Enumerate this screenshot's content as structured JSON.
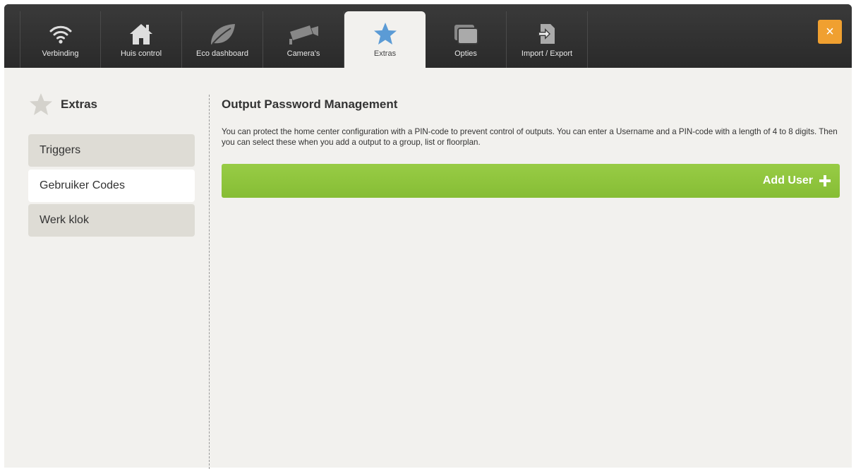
{
  "topbar": {
    "tabs": [
      {
        "label": "Verbinding",
        "icon": "wifi-icon"
      },
      {
        "label": "Huis control",
        "icon": "house-icon"
      },
      {
        "label": "Eco dashboard",
        "icon": "leaf-icon"
      },
      {
        "label": "Camera's",
        "icon": "camera-icon"
      },
      {
        "label": "Extras",
        "icon": "star-icon",
        "active": true
      },
      {
        "label": "Opties",
        "icon": "windows-icon"
      },
      {
        "label": "Import / Export",
        "icon": "import-export-icon"
      }
    ],
    "close_symbol": "×"
  },
  "sidebar": {
    "title": "Extras",
    "items": [
      {
        "label": "Triggers"
      },
      {
        "label": "Gebruiker Codes",
        "active": true
      },
      {
        "label": "Werk klok"
      }
    ]
  },
  "main": {
    "title": "Output Password Management",
    "description": "You can protect the home center configuration with a PIN-code to prevent control of outputs. You can enter a Username and a PIN-code with a length of 4 to 8 digits. Then you can select these when you add a output to a group, list or floorplan.",
    "add_user_label": "Add User"
  },
  "colors": {
    "accent_green": "#8dc43c",
    "close_orange": "#f0a030",
    "active_star": "#5b9bd5"
  }
}
